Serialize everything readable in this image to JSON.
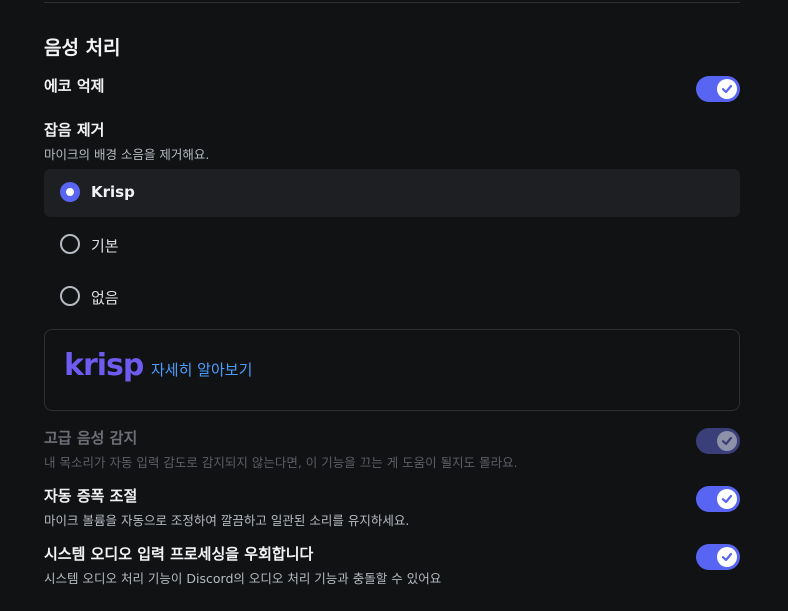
{
  "section": {
    "title": "음성 처리"
  },
  "echo_cancel": {
    "title": "에코 억제",
    "enabled": true,
    "icon": "check-icon"
  },
  "noise_suppression": {
    "title": "잡음 제거",
    "description": "마이크의 배경 소음을 제거해요.",
    "options": [
      {
        "label": "Krisp",
        "selected": true
      },
      {
        "label": "기본",
        "selected": false
      },
      {
        "label": "없음",
        "selected": false
      }
    ]
  },
  "krisp_card": {
    "logo_text": "krisp",
    "link_label": "자세히 알아보기"
  },
  "advanced_vad": {
    "title": "고급 음성 감지",
    "description": "내 목소리가 자동 입력 감도로 감지되지 않는다면, 이 기능을 끄는 게 도움이 될지도 몰라요.",
    "enabled": true,
    "disabled": true
  },
  "auto_gain": {
    "title": "자동 증폭 조절",
    "description": "마이크 볼륨을 자동으로 조정하여 깔끔하고 일관된 소리를 유지하세요.",
    "enabled": true
  },
  "bypass_system": {
    "title": "시스템 오디오 입력 프로세싱을 우회합니다",
    "description": "시스템 오디오 처리 기능이 Discord의 오디오 처리 기능과 충돌할 수 있어요",
    "enabled": true
  },
  "colors": {
    "accent": "#5865f2",
    "link": "#4b9dff",
    "krisp_brand": "#6e5bf0",
    "background": "#111214"
  }
}
